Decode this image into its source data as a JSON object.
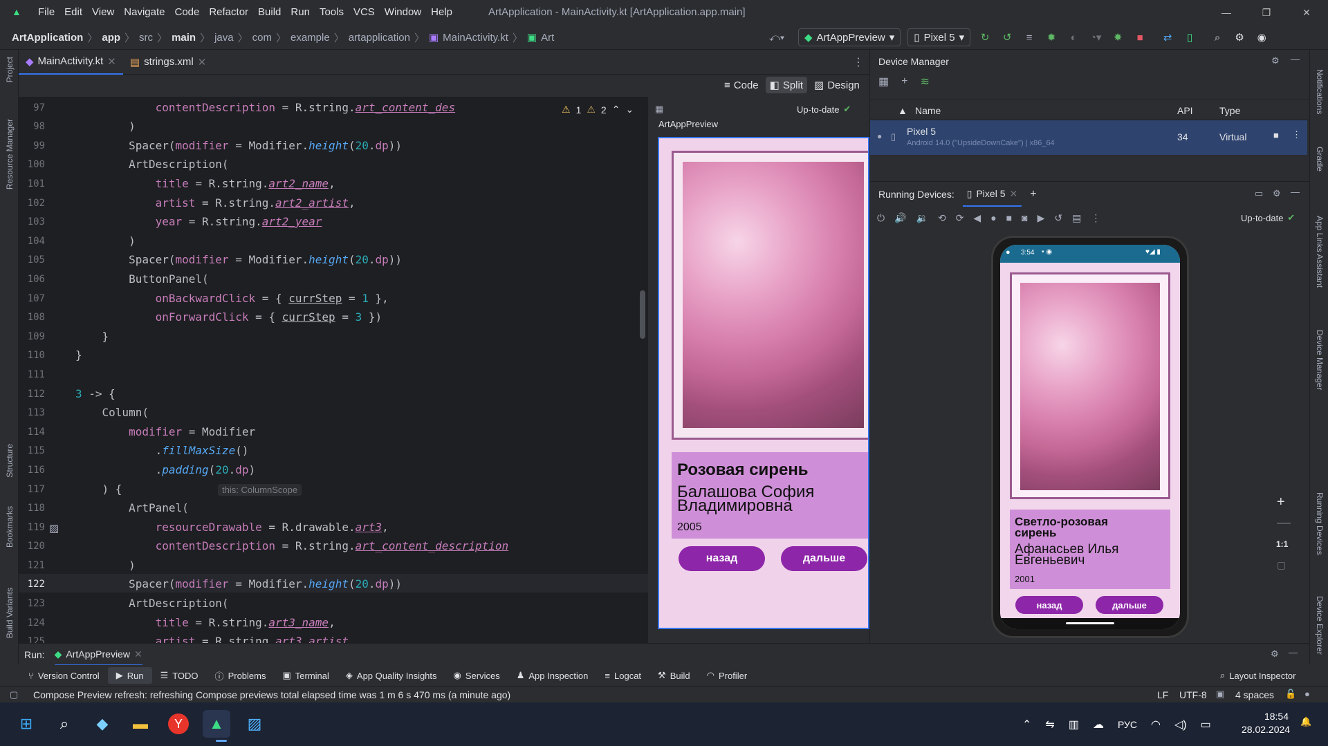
{
  "window": {
    "menu": [
      "File",
      "Edit",
      "View",
      "Navigate",
      "Code",
      "Refactor",
      "Build",
      "Run",
      "Tools",
      "VCS",
      "Window",
      "Help"
    ],
    "title": "ArtApplication - MainActivity.kt [ArtApplication.app.main]"
  },
  "breadcrumb": [
    "ArtApplication",
    "app",
    "src",
    "main",
    "java",
    "com",
    "example",
    "artapplication",
    "MainActivity.kt",
    "Art"
  ],
  "toolbar": {
    "run_config": "ArtAppPreview",
    "device": "Pixel 5"
  },
  "left_strip": [
    "Project",
    "Resource Manager",
    "Structure",
    "Bookmarks",
    "Build Variants"
  ],
  "right_strip": [
    "Notifications",
    "Gradle",
    "App Links Assistant",
    "Device Manager",
    "Running Devices",
    "Device Explorer"
  ],
  "editor_tabs": [
    {
      "label": "MainActivity.kt",
      "active": true
    },
    {
      "label": "strings.xml",
      "active": false
    }
  ],
  "view_modes": {
    "code": "Code",
    "split": "Split",
    "design": "Design"
  },
  "inspection": {
    "warn1": "1",
    "warn2": "2"
  },
  "code_lines": [
    {
      "n": "97"
    },
    {
      "n": "98"
    },
    {
      "n": "99"
    },
    {
      "n": "100"
    },
    {
      "n": "101"
    },
    {
      "n": "102"
    },
    {
      "n": "103"
    },
    {
      "n": "104"
    },
    {
      "n": "105"
    },
    {
      "n": "106"
    },
    {
      "n": "107"
    },
    {
      "n": "108"
    },
    {
      "n": "109"
    },
    {
      "n": "110"
    },
    {
      "n": "111"
    },
    {
      "n": "112"
    },
    {
      "n": "113"
    },
    {
      "n": "114"
    },
    {
      "n": "115"
    },
    {
      "n": "116"
    },
    {
      "n": "117"
    },
    {
      "n": "118"
    },
    {
      "n": "119"
    },
    {
      "n": "120"
    },
    {
      "n": "121"
    },
    {
      "n": "122"
    },
    {
      "n": "123"
    },
    {
      "n": "124"
    },
    {
      "n": "125"
    }
  ],
  "code_hint": "this: ColumnScope",
  "preview": {
    "status": "Up-to-date",
    "name": "ArtAppPreview",
    "title": "Розовая сирень",
    "artist": "Балашова София Владимировна",
    "year": "2005",
    "back": "назад",
    "next": "дальше"
  },
  "device_manager": {
    "title": "Device Manager",
    "col_name": "Name",
    "col_api": "API",
    "col_type": "Type",
    "device_name": "Pixel 5",
    "device_sub": "Android 14.0 (\"UpsideDownCake\") | x86_64",
    "device_api": "34",
    "device_type": "Virtual"
  },
  "running_devices": {
    "label": "Running Devices:",
    "tab": "Pixel 5",
    "status": "Up-to-date",
    "phone_time": "3:54",
    "title": "Светло-розовая сирень",
    "artist": "Афанасьев Илья Евгеньевич",
    "year": "2001",
    "back": "назад",
    "next": "дальше",
    "zoom_label": "1:1"
  },
  "run_bar": {
    "label": "Run:",
    "config": "ArtAppPreview"
  },
  "tool_windows": [
    "Version Control",
    "Run",
    "TODO",
    "Problems",
    "Terminal",
    "App Quality Insights",
    "Services",
    "App Inspection",
    "Logcat",
    "Build",
    "Profiler"
  ],
  "layout_inspector": "Layout Inspector",
  "status": {
    "message": "Compose Preview refresh: refreshing Compose previews total elapsed time was 1 m 6 s 470 ms (a minute ago)",
    "line_sep": "LF",
    "encoding": "UTF-8",
    "indent": "4 spaces"
  },
  "taskbar": {
    "lang": "РУС",
    "time": "18:54",
    "date": "28.02.2024"
  }
}
